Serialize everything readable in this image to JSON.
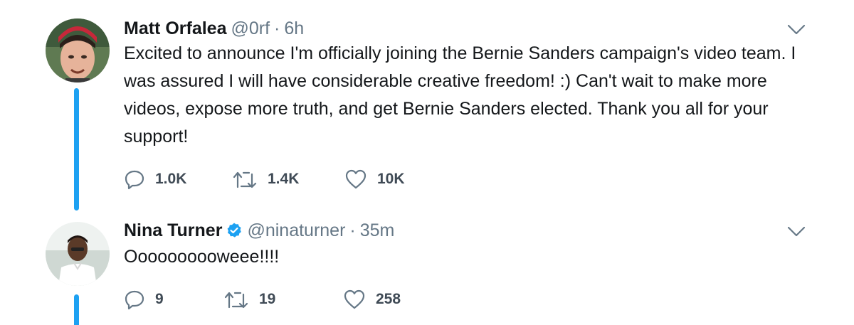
{
  "tweets": [
    {
      "name": "Matt Orfalea",
      "handle": "@0rf",
      "separator": "·",
      "time": "6h",
      "verified": false,
      "text": "Excited to announce I'm officially joining the Bernie Sanders campaign's video team. I was assured I will have considerable creative freedom! :) Can't wait to make more videos, expose more truth, and get Bernie Sanders elected. Thank you all for your support!",
      "replies": "1.0K",
      "retweets": "1.4K",
      "likes": "10K"
    },
    {
      "name": "Nina Turner",
      "handle": "@ninaturner",
      "separator": "·",
      "time": "35m",
      "verified": true,
      "text": "Oooooooooweee!!!!",
      "replies": "9",
      "retweets": "19",
      "likes": "258"
    }
  ],
  "colors": {
    "accent": "#1da1f2",
    "text": "#14171a",
    "secondary": "#657786"
  },
  "icons": [
    "avatar",
    "chevron-down-icon",
    "reply-icon",
    "retweet-icon",
    "like-icon",
    "verified-badge-icon"
  ]
}
